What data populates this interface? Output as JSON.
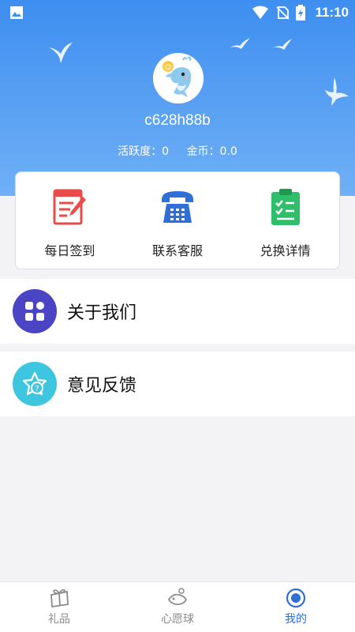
{
  "status_bar": {
    "time": "11:10",
    "icons": [
      "gallery-icon",
      "wifi-icon",
      "no-sim-icon",
      "battery-charging-icon"
    ]
  },
  "profile": {
    "username": "c628h88b",
    "activity_label": "活跃度：",
    "activity_value": "0",
    "coins_label": "金币：",
    "coins_value": "0.0",
    "avatar_icon": "dolphin-avatar"
  },
  "actions": [
    {
      "label": "每日签到",
      "icon": "sign-in-icon",
      "color": "#e94b4b"
    },
    {
      "label": "联系客服",
      "icon": "telephone-icon",
      "color": "#2f6fd8"
    },
    {
      "label": "兑换详情",
      "icon": "clipboard-check-icon",
      "color": "#2fbf6b"
    }
  ],
  "menu": [
    {
      "label": "关于我们",
      "icon": "apps-grid-icon",
      "color": "#4b45c6"
    },
    {
      "label": "意见反馈",
      "icon": "feedback-star-icon",
      "color": "#3ec6e0"
    }
  ],
  "bottom_nav": [
    {
      "label": "礼品",
      "icon": "gift-box-icon",
      "active": false
    },
    {
      "label": "心愿球",
      "icon": "wish-ball-icon",
      "active": false
    },
    {
      "label": "我的",
      "icon": "profile-ring-icon",
      "active": true
    }
  ],
  "colors": {
    "header_blue": "#3d8ef0",
    "active_tab": "#2f6fd8",
    "inactive_tab": "#8a8a8a"
  }
}
